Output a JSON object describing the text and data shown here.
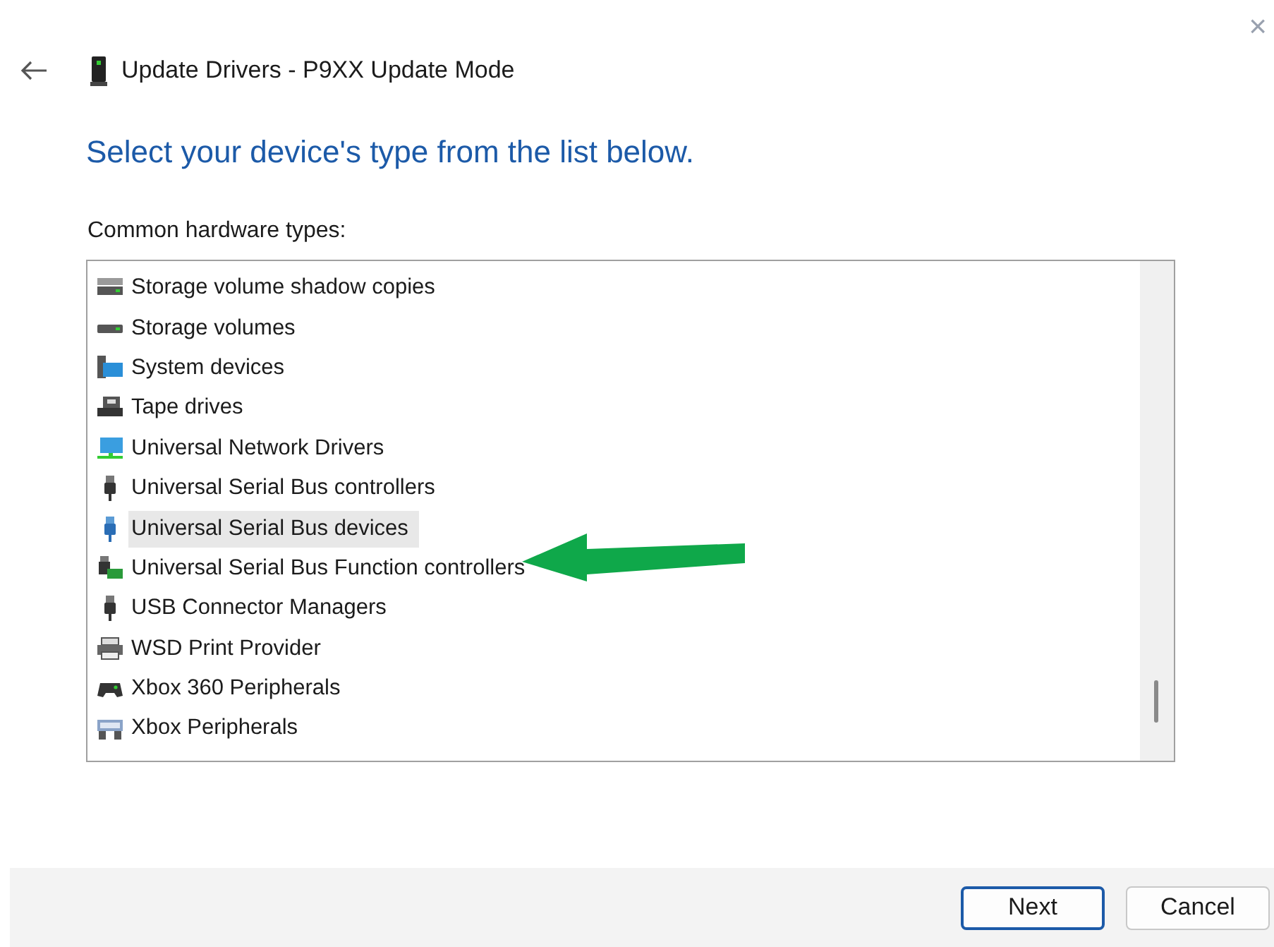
{
  "window": {
    "close": "×"
  },
  "header": {
    "title": "Update Drivers - P9XX Update Mode"
  },
  "heading": "Select your device's type from the list below.",
  "list_label": "Common hardware types:",
  "items": [
    {
      "label": "Storage volume shadow copies",
      "kind": "drive",
      "selected": false
    },
    {
      "label": "Storage volumes",
      "kind": "volume",
      "selected": false
    },
    {
      "label": "System devices",
      "kind": "system",
      "selected": false
    },
    {
      "label": "Tape drives",
      "kind": "tape",
      "selected": false
    },
    {
      "label": "Universal Network Drivers",
      "kind": "network",
      "selected": false
    },
    {
      "label": "Universal Serial Bus controllers",
      "kind": "usb",
      "selected": false
    },
    {
      "label": "Universal Serial Bus devices",
      "kind": "usbdevice",
      "selected": true
    },
    {
      "label": "Universal Serial Bus Function controllers",
      "kind": "usbfunction",
      "selected": false
    },
    {
      "label": "USB Connector Managers",
      "kind": "usb",
      "selected": false
    },
    {
      "label": "WSD Print Provider",
      "kind": "printer",
      "selected": false
    },
    {
      "label": "Xbox 360 Peripherals",
      "kind": "gamepad",
      "selected": false
    },
    {
      "label": "Xbox Peripherals",
      "kind": "keyboard",
      "selected": false
    }
  ],
  "buttons": [
    {
      "label": "Next",
      "default": true
    },
    {
      "label": "Cancel",
      "default": false
    }
  ]
}
